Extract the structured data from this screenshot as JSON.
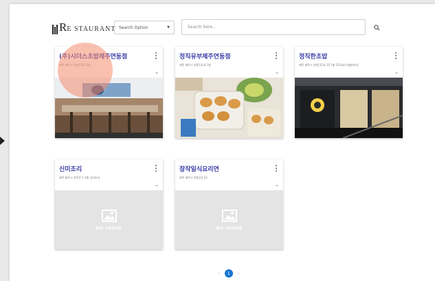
{
  "header": {
    "logo_text": "E STAURANT",
    "logo_big": "R",
    "search_option_label": "Search Option",
    "search_placeholder": "Search here..."
  },
  "cards": [
    {
      "title": "(주)시더스초밥제주연동점",
      "address": "제주 제주시 연삼로 81 1층"
    },
    {
      "title": "정직유부제주연동점",
      "address": "제주 제주시 연동1길 8 1층"
    },
    {
      "title": "정직한초밥",
      "address": "제주 제주시 (연동12길 10 1층 101호(노형빌리지)"
    },
    {
      "title": "신미조리",
      "address": "제주 제주시 관덕로 2 1층 신미조리"
    },
    {
      "title": "창작일식요리연",
      "address": "제주 제주시 연동2길 22"
    }
  ],
  "no_image_label": "NO IMAGE",
  "pagination": {
    "current": "1",
    "prev": "‹",
    "next": "›"
  },
  "colors": {
    "title": "#3b3ba8",
    "ripple": "#f58c6e",
    "pager": "#1976d2"
  }
}
